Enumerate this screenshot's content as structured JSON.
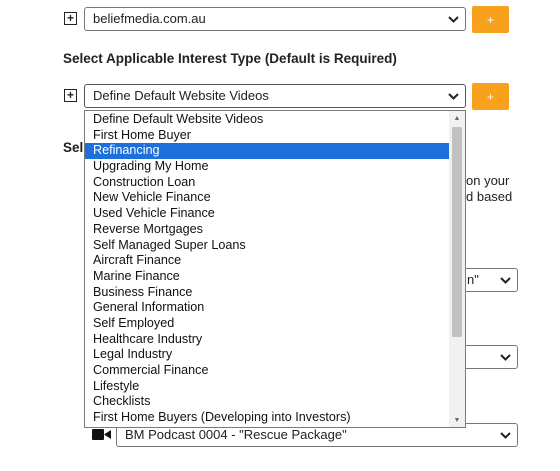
{
  "domain_select": {
    "value": "beliefmedia.com.au",
    "button_label": "+"
  },
  "interest_section": {
    "label": "Select Applicable Interest Type (Default is Required)"
  },
  "interest_select": {
    "value": "Define Default Website Videos",
    "button_label": "+"
  },
  "background": {
    "cut_label": "Sel",
    "side_text_1": "on your",
    "side_text_2": "d based",
    "partial_select_value": "n\"",
    "podcast_select_value": "BM Podcast 0004 - \"Rescue Package\""
  },
  "dropdown": {
    "selected_index": 2,
    "options": [
      "Define Default Website Videos",
      "First Home Buyer",
      "Refinancing",
      "Upgrading My Home",
      "Construction Loan",
      "New Vehicle Finance",
      "Used Vehicle Finance",
      "Reverse Mortgages",
      "Self Managed Super Loans",
      "Aircraft Finance",
      "Marine Finance",
      "Business Finance",
      "General Information",
      "Self Employed",
      "Healthcare Industry",
      "Legal Industry",
      "Commercial Finance",
      "Lifestyle",
      "Checklists",
      "First Home Buyers (Developing into Investors)"
    ]
  },
  "colors": {
    "accent_button": "#f8a11c",
    "selected_option": "#1e6fd9"
  },
  "icons": [
    "plus-square-icon",
    "chevron-down-icon",
    "video-camera-icon",
    "scroll-up-icon",
    "scroll-down-icon"
  ]
}
